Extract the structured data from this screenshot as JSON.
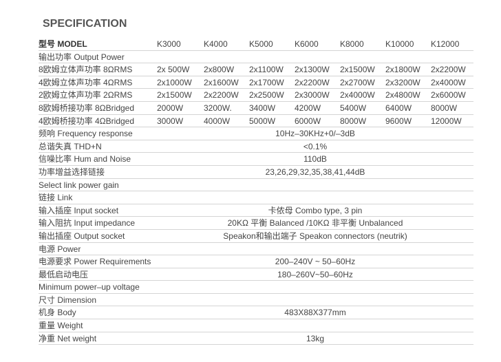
{
  "title": "SPECIFICATION",
  "models": [
    "K3000",
    "K4000",
    "K5000",
    "K6000",
    "K8000",
    "K10000",
    "K12000"
  ],
  "model_label": "型号 MODEL",
  "rows": [
    {
      "label": "输出功率 Output Power",
      "type": "section"
    },
    {
      "label": "8欧姆立体声功率 8ΩRMS",
      "type": "multi",
      "values": [
        "2x 500W",
        "2x800W",
        "2x1100W",
        "2x1300W",
        "2x1500W",
        "2x1800W",
        "2x2200W"
      ]
    },
    {
      "label": "4欧姆立体声功率 4ΩRMS",
      "type": "multi",
      "values": [
        "2x1000W",
        "2x1600W",
        "2x1700W",
        "2x2200W",
        "2x2700W",
        "2x3200W",
        "2x4000W"
      ]
    },
    {
      "label": "2欧姆立体声功率 2ΩRMS",
      "type": "multi",
      "values": [
        "2x1500W",
        "2x2200W",
        "2x2500W",
        "2x3000W",
        "2x4000W",
        "2x4800W",
        "2x6000W"
      ]
    },
    {
      "label": "8欧姆桥接功率 8ΩBridged",
      "type": "multi",
      "values": [
        "2000W",
        "3200W.",
        "3400W",
        "4200W",
        "5400W",
        "6400W",
        "8000W"
      ]
    },
    {
      "label": "4欧姆桥接功率 4ΩBridged",
      "type": "multi",
      "values": [
        "3000W",
        "4000W",
        "5000W",
        "6000W",
        "8000W",
        "9600W",
        "12000W"
      ]
    },
    {
      "label": "频响 Frequency response",
      "type": "span",
      "value": "10Hz–30KHz+0/–3dB"
    },
    {
      "label": "总谐失真 THD+N",
      "type": "span",
      "value": "<0.1%"
    },
    {
      "label": "信噪比率 Hum and Noise",
      "type": "span",
      "value": "110dB"
    },
    {
      "label": "功率增益选择链接",
      "type": "span",
      "value": "23,26,29,32,35,38,41,44dB"
    },
    {
      "label": "Select link power gain",
      "type": "section"
    },
    {
      "label": "链接 Link",
      "type": "section"
    },
    {
      "label": "输入插座 Input socket",
      "type": "span",
      "value": "卡侬母 Combo type, 3 pin"
    },
    {
      "label": "输入阻抗 Input impedance",
      "type": "span",
      "value": "20KΩ 平衡 Balanced /10KΩ 非平衡 Unbalanced"
    },
    {
      "label": "输出插座 Output socket",
      "type": "span",
      "value": "Speakon和输出端子 Speakon connectors (neutrik)"
    },
    {
      "label": "电源 Power",
      "type": "section"
    },
    {
      "label": "电源要求 Power Requirements",
      "type": "span",
      "value": "200–240V ~ 50–60Hz"
    },
    {
      "label": "最低启动电压",
      "type": "span",
      "value": "180–260V~50–60Hz"
    },
    {
      "label": "Minimum power–up voltage",
      "type": "section"
    },
    {
      "label": "尺寸 Dimension",
      "type": "section"
    },
    {
      "label": "机身 Body",
      "type": "span",
      "value": "483X88X377mm"
    },
    {
      "label": "重量 Weight",
      "type": "section"
    },
    {
      "label": "净重 Net weight",
      "type": "span",
      "value": "13kg"
    }
  ]
}
